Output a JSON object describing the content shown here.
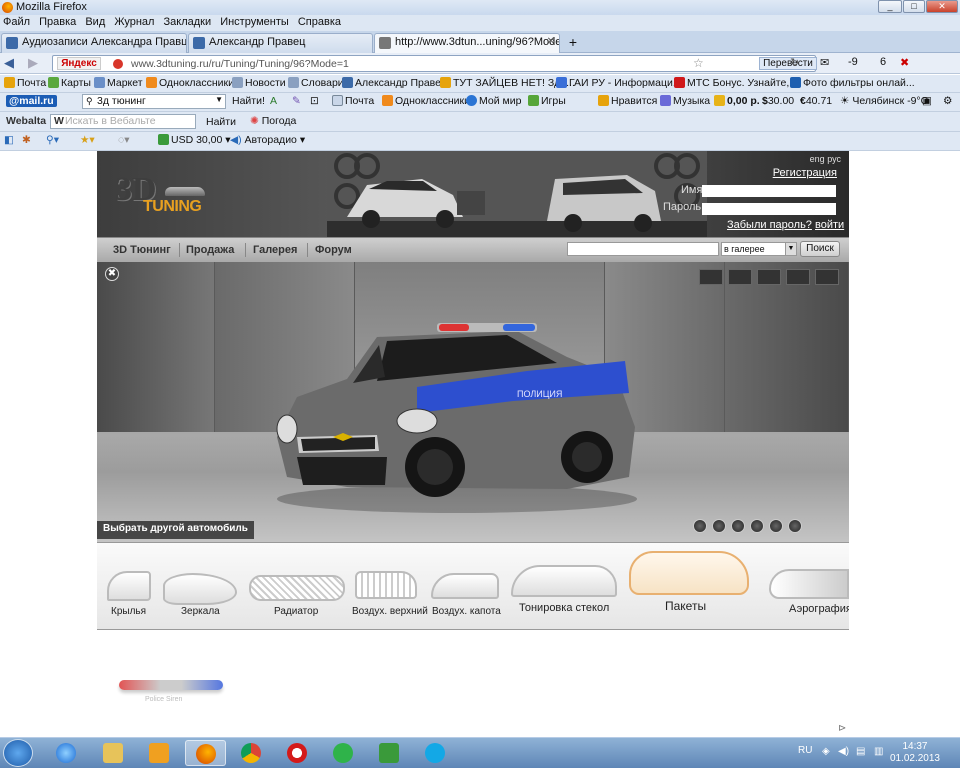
{
  "window": {
    "title": "Mozilla Firefox"
  },
  "menu": [
    "Файл",
    "Правка",
    "Вид",
    "Журнал",
    "Закладки",
    "Инструменты",
    "Справка"
  ],
  "tabs": [
    {
      "label": "Аудиозаписи Александра Правца | ...",
      "active": false
    },
    {
      "label": "Александр Правец",
      "active": false
    },
    {
      "label": "http://www.3dtun...uning/96?Mode=1",
      "active": true
    }
  ],
  "nav": {
    "yandex": "Яндекс",
    "url": "www.3dtuning.ru/ru/Tuning/Tuning/96?Mode=1",
    "translate_label": "Перевести",
    "badge_mail": "-9",
    "badge_count": "6"
  },
  "bookmarks": [
    "Почта",
    "Карты",
    "Маркет",
    "Одноклассники",
    "Новости",
    "Словари",
    "Александр Правец",
    "ТУТ ЗАЙЦЕВ НЕТ! Зде...",
    "ГАИ РУ - Информаци...",
    "МТС Бонус. Узнайте, ...",
    "Фото фильтры онлай..."
  ],
  "mailru_bar": {
    "logo": "@mail.ru",
    "search_value": "3д тюнинг",
    "find_label": "Найти!",
    "links": [
      "Почта",
      "Одноклассники",
      "Мой мир",
      "Игры",
      "Нравится",
      "Музыка"
    ],
    "money": "0,00 р.",
    "usd": "30.00",
    "eur": "40.71",
    "weather": "Челябинск -9°C"
  },
  "webalta_bar": {
    "logo": "Webalta",
    "search_placeholder": "Искать в Вебальте",
    "find_label": "Найти",
    "weather_label": "Погода"
  },
  "extra_bar": {
    "usd_label": "USD 30,00",
    "radio_label": "Авторадио"
  },
  "site": {
    "logo_3d": "3D",
    "logo_tuning": "TUNING",
    "lang": "eng рус",
    "register": "Регистрация",
    "name_label": "Имя",
    "password_label": "Пароль",
    "forgot": "Забыли пароль?",
    "login": "войти",
    "nav": [
      "3D Тюнинг",
      "Продажа",
      "Галерея",
      "Форум"
    ],
    "search_scope": "в галерее",
    "search_button": "Поиск",
    "choose_car": "Выбрать другой автомобиль",
    "car_decal": "ПОЛИЦИЯ",
    "parts": [
      "Крылья",
      "Зеркала",
      "Радиатор",
      "Воздух. верхний",
      "Воздух. капота",
      "Тонировка стекол",
      "Пакеты",
      "Аэрография"
    ],
    "livery_caption": "Police Siren"
  },
  "taskbar": {
    "lang": "RU",
    "time": "14:37",
    "date": "01.02.2013"
  },
  "colors": {
    "accent": "#e8a020",
    "police_blue": "#2d4fcf",
    "car_gray": "#6b6b6b"
  }
}
